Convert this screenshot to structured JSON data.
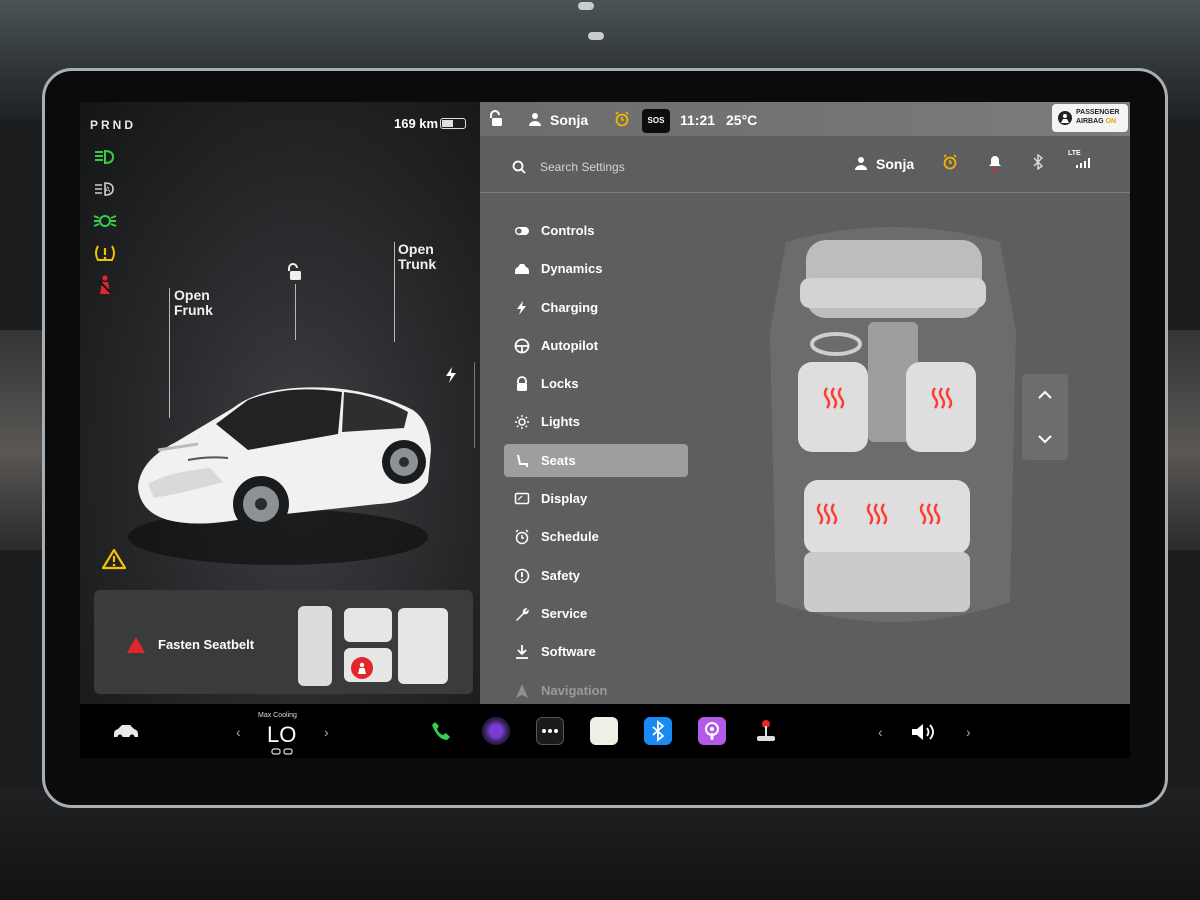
{
  "car": {
    "gear": "PRND",
    "range": "169 km",
    "battery_level": 0.45,
    "frunk_label_1": "Open",
    "frunk_label_2": "Frunk",
    "trunk_label_1": "Open",
    "trunk_label_2": "Trunk",
    "telltales": [
      "headlights-icon",
      "auto-headlights-icon",
      "parking-lights-icon",
      "tire-pressure-icon",
      "seatbelt-warning-icon"
    ],
    "alert_text": "Fasten Seatbelt"
  },
  "status_bar": {
    "user": "Sonja",
    "sos": "SOS",
    "time": "11:21",
    "temperature": "25°C",
    "airbag_line1": "PASSENGER",
    "airbag_line2_prefix": "AIRBAG ",
    "airbag_status": "ON",
    "network": "LTE"
  },
  "settings": {
    "search_placeholder": "Search Settings",
    "user": "Sonja",
    "menu": [
      {
        "label": "Controls",
        "icon": "toggle-icon"
      },
      {
        "label": "Dynamics",
        "icon": "car-icon"
      },
      {
        "label": "Charging",
        "icon": "bolt-icon"
      },
      {
        "label": "Autopilot",
        "icon": "steering-wheel-icon"
      },
      {
        "label": "Locks",
        "icon": "lock-icon"
      },
      {
        "label": "Lights",
        "icon": "sun-icon"
      },
      {
        "label": "Seats",
        "icon": "seat-icon",
        "active": true
      },
      {
        "label": "Display",
        "icon": "display-icon"
      },
      {
        "label": "Schedule",
        "icon": "alarm-icon"
      },
      {
        "label": "Safety",
        "icon": "alert-circle-icon"
      },
      {
        "label": "Service",
        "icon": "wrench-icon"
      },
      {
        "label": "Software",
        "icon": "download-icon"
      },
      {
        "label": "Navigation",
        "icon": "navigation-icon"
      }
    ]
  },
  "dock": {
    "climate_caption": "Max Cooling",
    "climate_value": "LO",
    "apps": [
      "phone-icon",
      "camera-icon",
      "more-icon",
      "notes-icon",
      "bluetooth-icon",
      "podcast-icon",
      "toybox-icon"
    ]
  }
}
